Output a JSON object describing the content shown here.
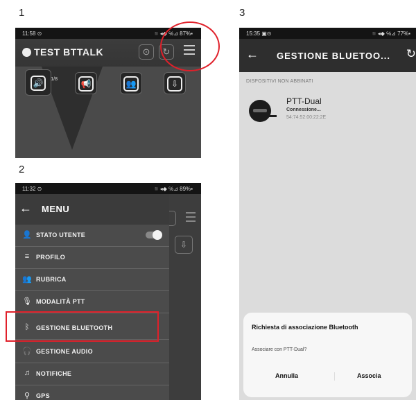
{
  "step_labels": [
    "1",
    "2",
    "3"
  ],
  "screen1": {
    "status_time": "11:58 ⊙",
    "status_right": "◾◂◆ ℅⊿ 87%▪",
    "app_title": "TEST BTTALK",
    "header_btn1": "⊙",
    "header_btn2": "↻",
    "tile1": "🔊",
    "tile1_sup": "1/8",
    "tile2": "📢",
    "tile3": "👥",
    "tile4": "⇩"
  },
  "screen2": {
    "status_time": "11:32 ⊙",
    "status_right": "◾◂◆ ℅⊿ 89%▪",
    "menu_title": "MENU",
    "items": [
      {
        "icon": "👤",
        "label": "STATO UTENTE"
      },
      {
        "icon": "≡",
        "label": "PROFILO"
      },
      {
        "icon": "👥",
        "label": "RUBRICA"
      },
      {
        "icon": "🎙",
        "label": "MODALITÀ PTT"
      },
      {
        "icon": "ᛒ",
        "label": "GESTIONE BLUETOOTH"
      },
      {
        "icon": "🎧",
        "label": "GESTIONE AUDIO"
      },
      {
        "icon": "♫",
        "label": "NOTIFICHE"
      },
      {
        "icon": "⚲",
        "label": "GPS"
      }
    ]
  },
  "screen3": {
    "status_time": "15:35 ▣⊙",
    "status_right": "◾◂◆ ℅⊿ 77%▪",
    "title": "GESTIONE BLUETOO...",
    "refresh": "↻",
    "section": "DISPOSITIVI NON ABBINATI",
    "device_name": "PTT-Dual",
    "device_status": "Connessione...",
    "device_mac": "54:74:52:00:22:2E",
    "dialog_title": "Richiesta di associazione Bluetooth",
    "dialog_message": "Associare con PTT-Dual?",
    "cancel_label": "Annulla",
    "confirm_label": "Associa"
  }
}
